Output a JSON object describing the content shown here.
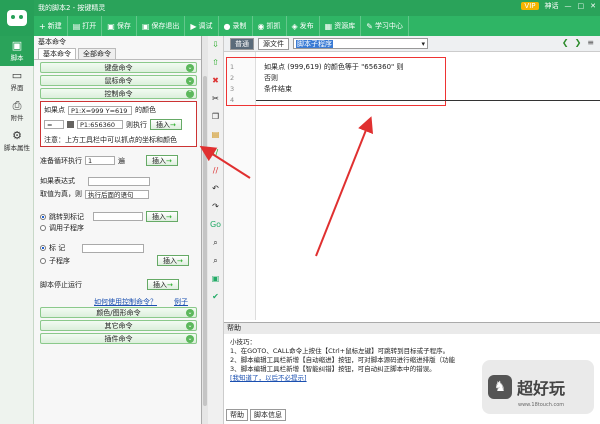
{
  "window": {
    "title": "我的脚本2 - 按键精灵",
    "vip": "VIP",
    "badge": "神话"
  },
  "toolbar": [
    {
      "icon": "+",
      "label": "新建"
    },
    {
      "icon": "▤",
      "label": "打开"
    },
    {
      "icon": "▣",
      "label": "保存"
    },
    {
      "icon": "▣",
      "label": "保存退出"
    },
    {
      "icon": "▶",
      "label": "调试"
    },
    {
      "icon": "●",
      "label": "录制"
    },
    {
      "icon": "◉",
      "label": "抓抓"
    },
    {
      "icon": "◈",
      "label": "发布"
    },
    {
      "icon": "▦",
      "label": "资源库"
    },
    {
      "icon": "✎",
      "label": "学习中心"
    }
  ],
  "nav": [
    {
      "icon": "▣",
      "label": "脚本"
    },
    {
      "icon": "▭",
      "label": "界面"
    },
    {
      "icon": "⎙",
      "label": "附件"
    },
    {
      "icon": "⚙",
      "label": "脚本属性"
    }
  ],
  "panel": {
    "title": "基本命令",
    "tabs": [
      "基本命令",
      "全部命令"
    ],
    "categories_top": [
      "键盘命令",
      "鼠标命令"
    ],
    "control": {
      "label": "控制命令",
      "if_label": "如果点",
      "point_value": "P1:X=999 Y=619",
      "color_of": "的颜色",
      "op": "=",
      "color_value": "P1:656360",
      "then_label": "则执行",
      "insert": "插入",
      "note": "注意：上方工具栏中可以抓点的坐标和颜色"
    },
    "loop": {
      "label": "准备循环执行",
      "count": "1",
      "unit": "遍",
      "insert": "插入"
    },
    "cond": {
      "label": "如果表达式",
      "value": "",
      "truth_label": "取值为真，则",
      "action": "执行后面的语句"
    },
    "jump": {
      "radio1": "跳转到标记",
      "radio2": "调用子程序",
      "insert": "插入"
    },
    "mark": {
      "radio1": "标 记",
      "radio2": "子程序",
      "insert": "插入"
    },
    "stop": {
      "label": "脚本停止运行",
      "insert": "插入"
    },
    "help_link": "如何使用控制命令？",
    "example_link": "例子",
    "categories_bottom": [
      "颜色/图形命令",
      "其它命令",
      "插件命令"
    ]
  },
  "editor": {
    "tabs": [
      "普通",
      "源文件"
    ],
    "dropdown": "脚本子程序",
    "lines": [
      "1",
      "2",
      "3",
      "4"
    ],
    "code": [
      "如果点 (999,619) 的颜色等于 \"656360\" 则",
      "否则",
      "条件结束"
    ]
  },
  "help": {
    "title": "帮助",
    "heading": "小技巧：",
    "tips": [
      "1、在GOTO、CALL命令上按住【Ctrl+鼠标左键】可跳转到目标或子程序。",
      "2、脚本编辑工具栏新增【自动缩进】按钮，可对脚本源码进行缩进排版（功能",
      "3、脚本编辑工具栏新增【智能纠错】按钮，可自动纠正脚本中的错误。",
      "[我知道了，以后不必提示]"
    ],
    "tabs": [
      "帮助",
      "脚本信息"
    ]
  },
  "watermark": {
    "text": "超好玩",
    "url": "www.18touch.com"
  }
}
